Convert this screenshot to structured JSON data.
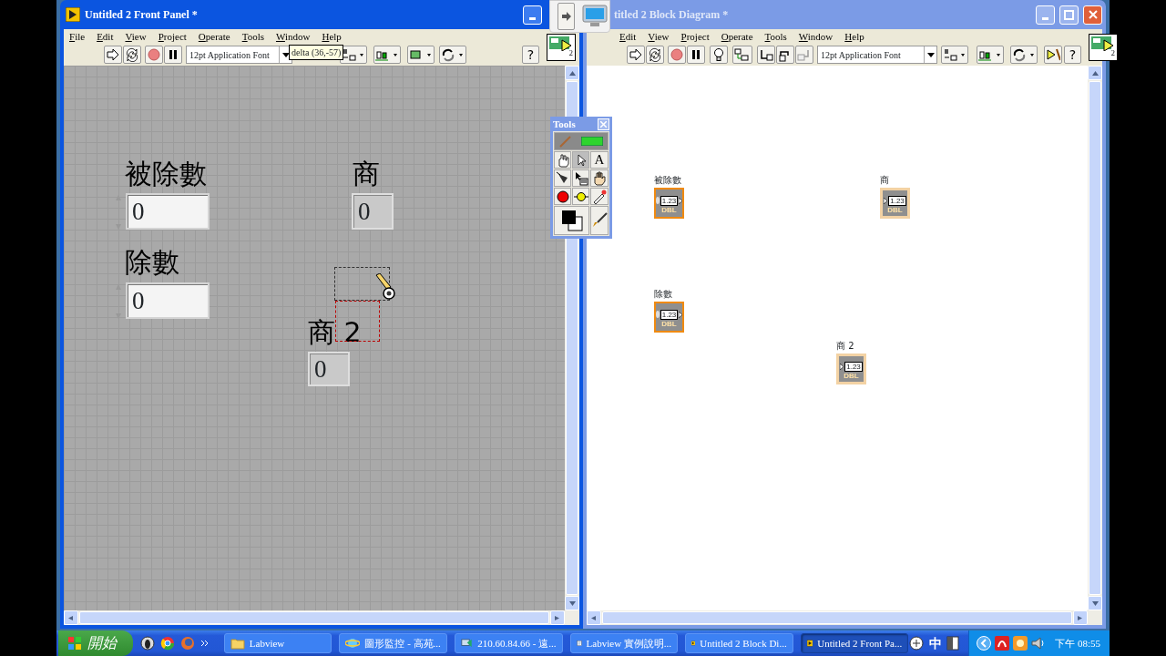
{
  "front_panel": {
    "title": "Untitled 2 Front Panel *",
    "active": true,
    "menu": [
      "File",
      "Edit",
      "View",
      "Project",
      "Operate",
      "Tools",
      "Window",
      "Help"
    ],
    "font_selector": "12pt Application Font",
    "help": "?",
    "icon_number": "2",
    "tooltip": "delta (36,-57)",
    "objects": [
      {
        "label": "被除數",
        "kind": "control",
        "value": "0"
      },
      {
        "label": "商",
        "kind": "indicator",
        "value": "0"
      },
      {
        "label": "除數",
        "kind": "control",
        "value": "0"
      },
      {
        "label": "商 2",
        "kind": "indicator",
        "value": "0"
      }
    ]
  },
  "block_diagram": {
    "title": "titled 2 Block Diagram *",
    "active": false,
    "menu": [
      "Edit",
      "View",
      "Project",
      "Operate",
      "Tools",
      "Window",
      "Help"
    ],
    "font_selector": "12pt Application Font",
    "help": "?",
    "icon_number": "2",
    "terminals": [
      {
        "label": "被除數",
        "kind": "control",
        "display": "1.23",
        "type": "DBL"
      },
      {
        "label": "商",
        "kind": "indicator",
        "display": "1.23",
        "type": "DBL"
      },
      {
        "label": "除數",
        "kind": "control",
        "display": "1.23",
        "type": "DBL"
      },
      {
        "label": "商 2",
        "kind": "indicator",
        "display": "1.23",
        "type": "DBL"
      }
    ]
  },
  "tools_palette": {
    "title": "Tools",
    "text_tool": "A"
  },
  "taskbar": {
    "start": "開始",
    "buttons": [
      {
        "label": "Labview",
        "selected": false
      },
      {
        "label": "圖形監控 - 高苑...",
        "selected": false
      },
      {
        "label": "210.60.84.66 - 遠...",
        "selected": false
      },
      {
        "label": "Labview 實例說明...",
        "selected": false
      },
      {
        "label": "Untitled 2 Block Di...",
        "selected": false
      },
      {
        "label": "Untitled 2 Front Pa...",
        "selected": true
      }
    ],
    "ime": "中",
    "clock": "下午 08:55"
  }
}
